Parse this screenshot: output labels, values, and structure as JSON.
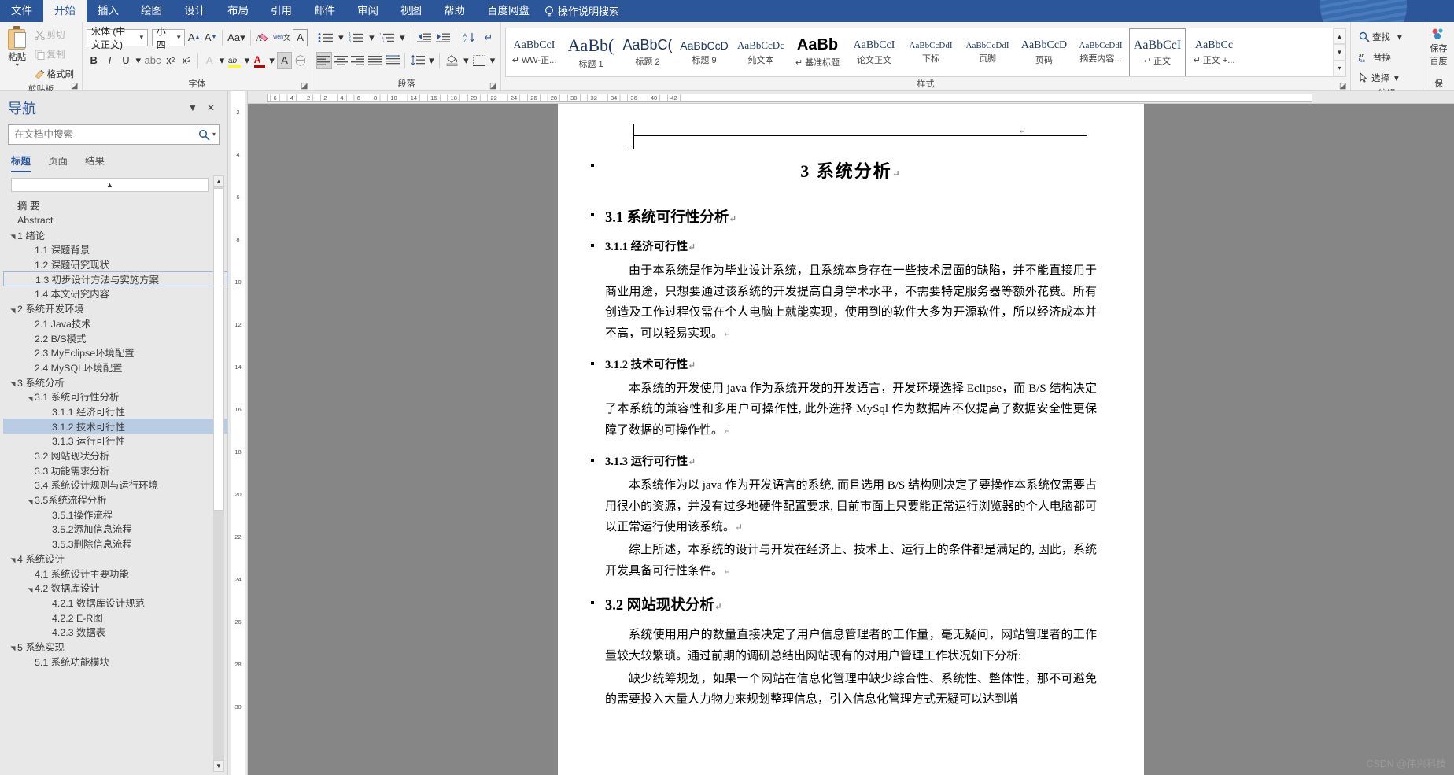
{
  "ribbon": {
    "tabs": [
      "文件",
      "开始",
      "插入",
      "绘图",
      "设计",
      "布局",
      "引用",
      "邮件",
      "审阅",
      "视图",
      "帮助",
      "百度网盘"
    ],
    "active_tab": "开始",
    "tellme": "操作说明搜索",
    "groups": {
      "clipboard": {
        "label": "剪贴板",
        "paste": "粘贴",
        "cut": "剪切",
        "copy": "复制",
        "format_painter": "格式刷"
      },
      "font": {
        "label": "字体",
        "font_name": "宋体 (中文正文)",
        "font_size": "小四",
        "grow": "A",
        "shrink": "A",
        "change_case": "Aa",
        "clear_format": "清除所有格式",
        "bold": "B",
        "italic": "I",
        "underline": "U",
        "strike": "abc",
        "subscript": "x₂",
        "superscript": "x²",
        "text_effects": "A",
        "highlight": "aby",
        "font_color": "A",
        "char_shading": "A",
        "char_border": "字",
        "phonetic": "wén文"
      },
      "paragraph": {
        "label": "段落",
        "bullets": "项目符号",
        "numbering": "编号",
        "multilevel": "多级列表",
        "dec_indent": "减少缩进量",
        "inc_indent": "增加缩进量",
        "sort": "排序",
        "show_marks": "显示编辑标记",
        "align_left": "左对齐",
        "align_center": "居中",
        "align_right": "右对齐",
        "justify": "两端对齐",
        "distribute": "分散对齐",
        "line_spacing": "行和段落间距",
        "shading": "底纹",
        "borders": "边框"
      },
      "styles": {
        "label": "样式",
        "items": [
          {
            "preview": "AaBbCcI",
            "name": "↵ WW-正...",
            "selected": false
          },
          {
            "preview": "AaBb(",
            "name": "标题 1",
            "selected": false
          },
          {
            "preview": "AaBbC(",
            "name": "标题 2",
            "selected": false
          },
          {
            "preview": "AaBbCcD",
            "name": "标题 9",
            "selected": false
          },
          {
            "preview": "AaBbCcDc",
            "name": "纯文本",
            "selected": false
          },
          {
            "preview": "AaBb",
            "name": "↵ 基准标题",
            "selected": false
          },
          {
            "preview": "AaBbCcI",
            "name": "论文正文",
            "selected": false
          },
          {
            "preview": "AaBbCcDdI",
            "name": "下标",
            "selected": false
          },
          {
            "preview": "AaBbCcDdI",
            "name": "页脚",
            "selected": false
          },
          {
            "preview": "AaBbCcD",
            "name": "页码",
            "selected": false
          },
          {
            "preview": "AaBbCcDdI",
            "name": "摘要内容...",
            "selected": false
          },
          {
            "preview": "AaBbCcI",
            "name": "↵ 正文",
            "selected": true
          },
          {
            "preview": "AaBbCc",
            "name": "↵ 正文 +...",
            "selected": false
          }
        ]
      },
      "editing": {
        "label": "编辑",
        "find": "查找",
        "replace": "替换",
        "select": "选择"
      },
      "baidu": {
        "line1": "保存",
        "line2": "百度",
        "line3": "保"
      }
    }
  },
  "nav": {
    "title": "导航",
    "search_placeholder": "在文档中搜索",
    "search_value": "",
    "tabs": [
      "标题",
      "页面",
      "结果"
    ],
    "active_tab": "标题",
    "items": [
      {
        "label": "摘 要",
        "level": 0,
        "tri": "",
        "state": ""
      },
      {
        "label": "Abstract",
        "level": 0,
        "tri": "",
        "state": ""
      },
      {
        "label": "1 绪论",
        "level": 0,
        "tri": "▲",
        "state": ""
      },
      {
        "label": "1.1 课题背景",
        "level": 1,
        "tri": "",
        "state": ""
      },
      {
        "label": "1.2 课题研究现状",
        "level": 1,
        "tri": "",
        "state": ""
      },
      {
        "label": "1.3 初步设计方法与实施方案",
        "level": 1,
        "tri": "",
        "state": "box"
      },
      {
        "label": "1.4 本文研究内容",
        "level": 1,
        "tri": "",
        "state": ""
      },
      {
        "label": "2 系统开发环境",
        "level": 0,
        "tri": "▲",
        "state": ""
      },
      {
        "label": "2.1 Java技术",
        "level": 1,
        "tri": "",
        "state": ""
      },
      {
        "label": "2.2 B/S模式",
        "level": 1,
        "tri": "",
        "state": ""
      },
      {
        "label": "2.3 MyEclipse环境配置",
        "level": 1,
        "tri": "",
        "state": ""
      },
      {
        "label": "2.4 MySQL环境配置",
        "level": 1,
        "tri": "",
        "state": ""
      },
      {
        "label": "3 系统分析",
        "level": 0,
        "tri": "▲",
        "state": ""
      },
      {
        "label": "3.1 系统可行性分析",
        "level": 1,
        "tri": "▲",
        "state": ""
      },
      {
        "label": "3.1.1 经济可行性",
        "level": 2,
        "tri": "",
        "state": ""
      },
      {
        "label": "3.1.2 技术可行性",
        "level": 2,
        "tri": "",
        "state": "sel"
      },
      {
        "label": "3.1.3 运行可行性",
        "level": 2,
        "tri": "",
        "state": ""
      },
      {
        "label": "3.2 网站现状分析",
        "level": 1,
        "tri": "",
        "state": ""
      },
      {
        "label": "3.3 功能需求分析",
        "level": 1,
        "tri": "",
        "state": ""
      },
      {
        "label": "3.4 系统设计规则与运行环境",
        "level": 1,
        "tri": "",
        "state": ""
      },
      {
        "label": "3.5系统流程分析",
        "level": 1,
        "tri": "▲",
        "state": ""
      },
      {
        "label": "3.5.1操作流程",
        "level": 2,
        "tri": "",
        "state": ""
      },
      {
        "label": "3.5.2添加信息流程",
        "level": 2,
        "tri": "",
        "state": ""
      },
      {
        "label": "3.5.3删除信息流程",
        "level": 2,
        "tri": "",
        "state": ""
      },
      {
        "label": "4 系统设计",
        "level": 0,
        "tri": "▲",
        "state": ""
      },
      {
        "label": "4.1 系统设计主要功能",
        "level": 1,
        "tri": "",
        "state": ""
      },
      {
        "label": "4.2 数据库设计",
        "level": 1,
        "tri": "▲",
        "state": ""
      },
      {
        "label": "4.2.1 数据库设计规范",
        "level": 2,
        "tri": "",
        "state": ""
      },
      {
        "label": "4.2.2 E-R图",
        "level": 2,
        "tri": "",
        "state": ""
      },
      {
        "label": "4.2.3 数据表",
        "level": 2,
        "tri": "",
        "state": ""
      },
      {
        "label": "5 系统实现",
        "level": 0,
        "tri": "▲",
        "state": ""
      },
      {
        "label": "5.1  系统功能模块",
        "level": 1,
        "tri": "",
        "state": ""
      }
    ]
  },
  "rulers": {
    "horizontal": "｜6｜   ｜4｜  ｜2｜        ｜2｜   ｜4｜   ｜6｜   ｜8｜  ｜10｜  ｜14｜ ｜16｜ ｜18｜ ｜20｜  ｜22｜  ｜24｜  ｜26｜  ｜28｜  ｜30｜ ｜32｜  ｜34｜ ｜36｜          ｜40｜ ｜42｜",
    "vertical_ticks": [
      "2",
      "4",
      "6",
      "8",
      "10",
      "12",
      "14",
      "16",
      "18",
      "20",
      "22",
      "24",
      "26",
      "28",
      "30"
    ]
  },
  "document": {
    "header_pilcrow": "↵",
    "title": "3  系统分析",
    "blocks": [
      {
        "type": "h1",
        "text": "3  系统分析",
        "mark": "↵"
      },
      {
        "type": "h2",
        "text": "3.1  系统可行性分析",
        "mark": "↵"
      },
      {
        "type": "h3",
        "text": "3.1.1  经济可行性",
        "mark": "↵"
      },
      {
        "type": "p",
        "text": "由于本系统是作为毕业设计系统，且系统本身存在一些技术层面的缺陷，并不能直接用于商业用途，只想要通过该系统的开发提高自身学术水平，不需要特定服务器等额外花费。所有创造及工作过程仅需在个人电脑上就能实现，使用到的软件大多为开源软件，所以经济成本并不高，可以轻易实现。",
        "mark": "↵"
      },
      {
        "type": "h3",
        "text": "3.1.2  技术可行性",
        "mark": "↵"
      },
      {
        "type": "p",
        "text": "本系统的开发使用 java 作为系统开发的开发语言，开发环境选择 Eclipse，而 B/S 结构决定了本系统的兼容性和多用户可操作性, 此外选择 MySql 作为数据库不仅提高了数据安全性更保障了数据的可操作性。",
        "mark": "↵"
      },
      {
        "type": "h3",
        "text": "3.1.3  运行可行性",
        "mark": "↵"
      },
      {
        "type": "p",
        "text": "本系统作为以 java 作为开发语言的系统, 而且选用 B/S 结构则决定了要操作本系统仅需要占用很小的资源，并没有过多地硬件配置要求, 目前市面上只要能正常运行浏览器的个人电脑都可以正常运行使用该系统。",
        "mark": "↵"
      },
      {
        "type": "p",
        "text": "综上所述，本系统的设计与开发在经济上、技术上、运行上的条件都是满足的, 因此，系统开发具备可行性条件。",
        "mark": "↵"
      },
      {
        "type": "h2",
        "text": "3.2  网站现状分析",
        "mark": "↵"
      },
      {
        "type": "p",
        "text": "系统使用用户的数量直接决定了用户信息管理者的工作量，毫无疑问，网站管理者的工作量较大较繁琐。通过前期的调研总结出网站现有的对用户管理工作状况如下分析:",
        "mark": ""
      },
      {
        "type": "p",
        "text": "缺少统筹规划，如果一个网站在信息化管理中缺少综合性、系统性、整体性，那不可避免的需要投入大量人力物力来规划整理信息，引入信息化管理方式无疑可以达到增",
        "mark": ""
      }
    ]
  },
  "watermark": "CSDN @伟兴科技"
}
